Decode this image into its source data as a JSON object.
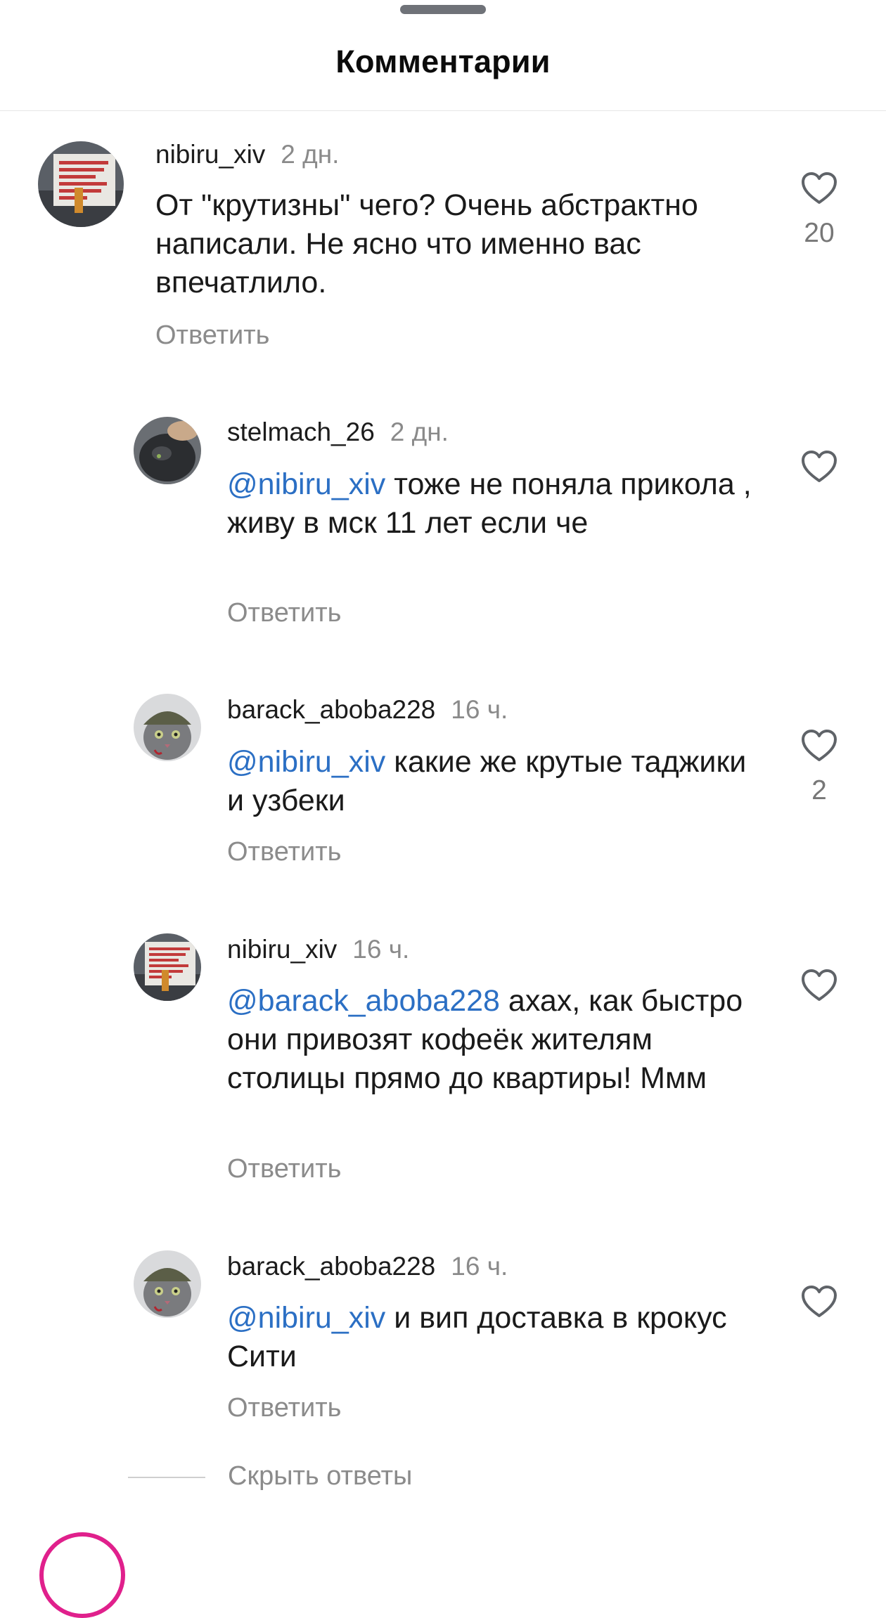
{
  "header": {
    "title": "Комментарии"
  },
  "comments": [
    {
      "username": "nibiru_xiv",
      "time": "2 дн.",
      "mention": "",
      "text": "От \"крутизны\" чего? Очень абстрактно написали. Не ясно что именно вас впечатлило.",
      "reply_label": "Ответить",
      "likes": "20",
      "avatar": "sign-avatar",
      "avatar_text": "С ПРАВИЛЬНЫМ ЧЕЛОВЕКОМ РЯДОМ НАЧИНАЕШЬ ЛЮБИТЬ СЕБЯ СИЛЬНЕЕ"
    },
    {
      "username": "stelmach_26",
      "time": "2 дн.",
      "mention": "@nibiru_xiv",
      "text": " тоже не поняла прикола , живу в мск 11 лет если че",
      "reply_label": "Ответить",
      "likes": "",
      "avatar": "cat-dark-avatar"
    },
    {
      "username": "barack_aboba228",
      "time": "16 ч.",
      "mention": "@nibiru_xiv",
      "text": " какие же крутые таджики и узбеки",
      "reply_label": "Ответить",
      "likes": "2",
      "avatar": "cat-helmet-avatar"
    },
    {
      "username": "nibiru_xiv",
      "time": "16 ч.",
      "mention": "@barack_aboba228",
      "text": " ахах, как быстро они привозят кофеёк жителям столицы прямо до квартиры! Ммм",
      "reply_label": "Ответить",
      "likes": "",
      "avatar": "sign-avatar",
      "avatar_text": "С ПРАВИЛЬНЫМ ЧЕЛОВЕКОМ РЯДОМ НАЧИНАЕШЬ ЛЮБИТЬ СЕБЯ СИЛЬНЕЕ"
    },
    {
      "username": "barack_aboba228",
      "time": "16 ч.",
      "mention": "@nibiru_xiv",
      "text": " и вип доставка в крокус Сити",
      "reply_label": "Ответить",
      "likes": "",
      "avatar": "cat-helmet-avatar"
    }
  ],
  "thread": {
    "hide_replies_label": "Скрыть ответы"
  },
  "colors": {
    "mention": "#2b6fc4",
    "secondary_text": "#8b8b8b",
    "heart_outline": "#5f6368",
    "story_ring": "#e0208c"
  },
  "icons": {
    "like": "heart-outline-icon"
  }
}
